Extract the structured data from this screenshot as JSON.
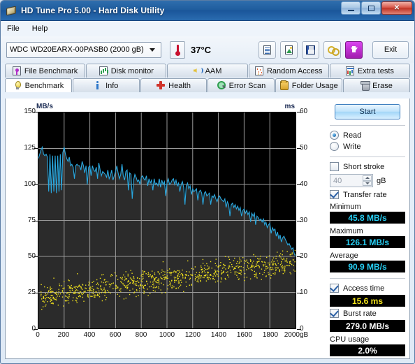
{
  "window": {
    "title": "HD Tune Pro 5.00 - Hard Disk Utility",
    "icon": "hdtune-disc-icon",
    "buttons": {
      "minimize": "minimize",
      "maximize": "maximize",
      "close": "✕"
    }
  },
  "menu": {
    "items": [
      {
        "label": "File"
      },
      {
        "label": "Help"
      }
    ]
  },
  "toolbar": {
    "drive": {
      "value": "WDC WD20EARX-00PASB0 (2000 gB)",
      "icon": "chevron-down-icon"
    },
    "temperature": {
      "icon": "thermometer-icon",
      "value": "37°C"
    },
    "icons": [
      {
        "name": "copy-text-icon"
      },
      {
        "name": "copy-image-icon"
      },
      {
        "name": "save-icon"
      },
      {
        "name": "cable-icon"
      },
      {
        "name": "download-icon"
      }
    ],
    "exit_label": "Exit"
  },
  "tabs": {
    "row1": [
      {
        "label": "File Benchmark",
        "icon": "file-benchmark-icon",
        "active": false
      },
      {
        "label": "Disk monitor",
        "icon": "disk-monitor-icon",
        "active": false
      },
      {
        "label": "AAM",
        "icon": "speaker-icon",
        "active": false
      },
      {
        "label": "Random Access",
        "icon": "random-access-icon",
        "active": false
      },
      {
        "label": "Extra tests",
        "icon": "extra-tests-icon",
        "active": false
      }
    ],
    "row2": [
      {
        "label": "Benchmark",
        "icon": "lightbulb-icon",
        "active": true
      },
      {
        "label": "Info",
        "icon": "info-icon",
        "active": false
      },
      {
        "label": "Health",
        "icon": "health-cross-icon",
        "active": false
      },
      {
        "label": "Error Scan",
        "icon": "magnifier-icon",
        "active": false
      },
      {
        "label": "Folder Usage",
        "icon": "folder-icon",
        "active": false
      },
      {
        "label": "Erase",
        "icon": "trash-icon",
        "active": false
      }
    ]
  },
  "sidebar": {
    "start_label": "Start",
    "mode": [
      {
        "label": "Read",
        "selected": true
      },
      {
        "label": "Write",
        "selected": false
      }
    ],
    "short_stroke": {
      "label": "Short stroke",
      "checked": false
    },
    "short_stroke_size": {
      "value": "40",
      "unit": "gB"
    },
    "transfer_rate": {
      "label": "Transfer rate",
      "checked": true
    },
    "stats": [
      {
        "label": "Minimum",
        "value": "45.8 MB/s",
        "color": "#27d0f5"
      },
      {
        "label": "Maximum",
        "value": "126.1 MB/s",
        "color": "#27d0f5"
      },
      {
        "label": "Average",
        "value": "90.9 MB/s",
        "color": "#27d0f5"
      }
    ],
    "access_time": {
      "label": "Access time",
      "checked": true,
      "value": "15.6 ms",
      "color": "#f2e31c"
    },
    "burst_rate": {
      "label": "Burst rate",
      "checked": true,
      "value": "279.0 MB/s",
      "color": "#ffffff"
    },
    "cpu_usage": {
      "label": "CPU usage",
      "value": "2.0%",
      "color": "#ffffff"
    }
  },
  "chart_data": {
    "type": "line",
    "title": "",
    "xlabel": "gB",
    "ylabel": "MB/s",
    "y2label": "ms",
    "xlim": [
      0,
      2000
    ],
    "ylim": [
      0,
      150
    ],
    "y2lim": [
      0,
      60
    ],
    "grid": true,
    "legend": "none",
    "x_ticks": [
      "0",
      "200",
      "400",
      "600",
      "800",
      "1000",
      "1200",
      "1400",
      "1600",
      "1800",
      "2000gB"
    ],
    "y_ticks": [
      "0",
      "25",
      "50",
      "75",
      "100",
      "125",
      "150"
    ],
    "y2_ticks": [
      "0",
      "10",
      "20",
      "30",
      "40",
      "50",
      "60"
    ],
    "series": [
      {
        "name": "Transfer rate",
        "axis": "left",
        "unit": "MB/s",
        "color": "#29a8e0",
        "x": [
          0,
          10,
          20,
          30,
          40,
          50,
          60,
          70,
          80,
          90,
          100,
          110,
          120,
          130,
          140,
          150,
          160,
          170,
          180,
          190,
          200,
          210,
          220,
          230,
          240,
          250,
          260,
          270,
          280,
          290,
          300,
          310,
          320,
          330,
          340,
          350,
          360,
          370,
          380,
          390,
          400,
          410,
          420,
          430,
          440,
          450,
          460,
          470,
          480,
          490,
          500,
          510,
          520,
          530,
          540,
          550,
          560,
          570,
          580,
          590,
          600,
          610,
          620,
          630,
          640,
          650,
          660,
          670,
          680,
          690,
          700,
          710,
          720,
          730,
          740,
          750,
          760,
          770,
          780,
          790,
          800,
          810,
          820,
          830,
          840,
          850,
          860,
          870,
          880,
          890,
          900,
          910,
          920,
          930,
          940,
          950,
          960,
          970,
          980,
          990,
          1000,
          1010,
          1020,
          1030,
          1040,
          1050,
          1060,
          1070,
          1080,
          1090,
          1100,
          1110,
          1120,
          1130,
          1140,
          1150,
          1160,
          1170,
          1180,
          1190,
          1200,
          1210,
          1220,
          1230,
          1240,
          1250,
          1260,
          1270,
          1280,
          1290,
          1300,
          1310,
          1320,
          1330,
          1340,
          1350,
          1360,
          1370,
          1380,
          1390,
          1400,
          1410,
          1420,
          1430,
          1440,
          1450,
          1460,
          1470,
          1480,
          1490,
          1500,
          1510,
          1520,
          1530,
          1540,
          1550,
          1560,
          1570,
          1580,
          1590,
          1600,
          1610,
          1620,
          1630,
          1640,
          1650,
          1660,
          1670,
          1680,
          1690,
          1700,
          1710,
          1720,
          1730,
          1740,
          1750,
          1760,
          1770,
          1780,
          1790,
          1800,
          1810,
          1820,
          1830,
          1840,
          1850,
          1860,
          1870,
          1880,
          1890,
          1900,
          1910,
          1920,
          1930,
          1940,
          1950,
          1960,
          1970,
          1980,
          1990,
          2000
        ],
        "y": [
          118,
          121,
          124,
          126,
          121,
          120,
          121,
          119,
          95,
          121,
          94,
          120,
          95,
          120,
          94,
          120,
          95,
          121,
          96,
          122,
          126,
          121,
          118,
          116,
          119,
          113,
          114,
          112,
          104,
          113,
          114,
          113,
          113,
          110,
          116,
          113,
          108,
          113,
          100,
          112,
          113,
          106,
          113,
          110,
          109,
          112,
          104,
          115,
          110,
          106,
          109,
          108,
          107,
          105,
          110,
          104,
          106,
          110,
          103,
          106,
          109,
          113,
          108,
          104,
          107,
          114,
          106,
          103,
          109,
          110,
          96,
          108,
          107,
          90,
          103,
          107,
          105,
          102,
          103,
          100,
          105,
          106,
          104,
          103,
          106,
          99,
          104,
          101,
          103,
          96,
          104,
          100,
          101,
          99,
          104,
          98,
          103,
          100,
          102,
          92,
          101,
          104,
          100,
          101,
          103,
          104,
          100,
          103,
          99,
          101,
          95,
          100,
          102,
          98,
          86,
          99,
          101,
          97,
          99,
          93,
          97,
          95,
          96,
          97,
          89,
          95,
          96,
          94,
          86,
          94,
          95,
          92,
          93,
          94,
          86,
          92,
          91,
          93,
          90,
          88,
          91,
          92,
          90,
          89,
          88,
          90,
          84,
          88,
          86,
          78,
          86,
          87,
          84,
          86,
          83,
          85,
          82,
          84,
          78,
          82,
          83,
          80,
          82,
          79,
          81,
          74,
          80,
          78,
          80,
          72,
          78,
          77,
          75,
          76,
          74,
          76,
          72,
          74,
          70,
          72,
          73,
          66,
          70,
          68,
          69,
          64,
          67,
          62,
          65,
          60,
          63,
          64,
          62,
          60,
          58,
          59,
          57,
          55,
          56,
          52,
          50
        ]
      },
      {
        "name": "Access time",
        "axis": "right",
        "unit": "ms",
        "color": "#f2e31c",
        "description": "Scatter cloud of random-seek access times; rises from about 5 ms near 0 gB to about 20 ms near 2000 gB, with vertical spread of roughly 8 ms",
        "average": 15.6,
        "range_start_ms": [
          4,
          14
        ],
        "range_end_ms": [
          14,
          24
        ]
      }
    ]
  }
}
